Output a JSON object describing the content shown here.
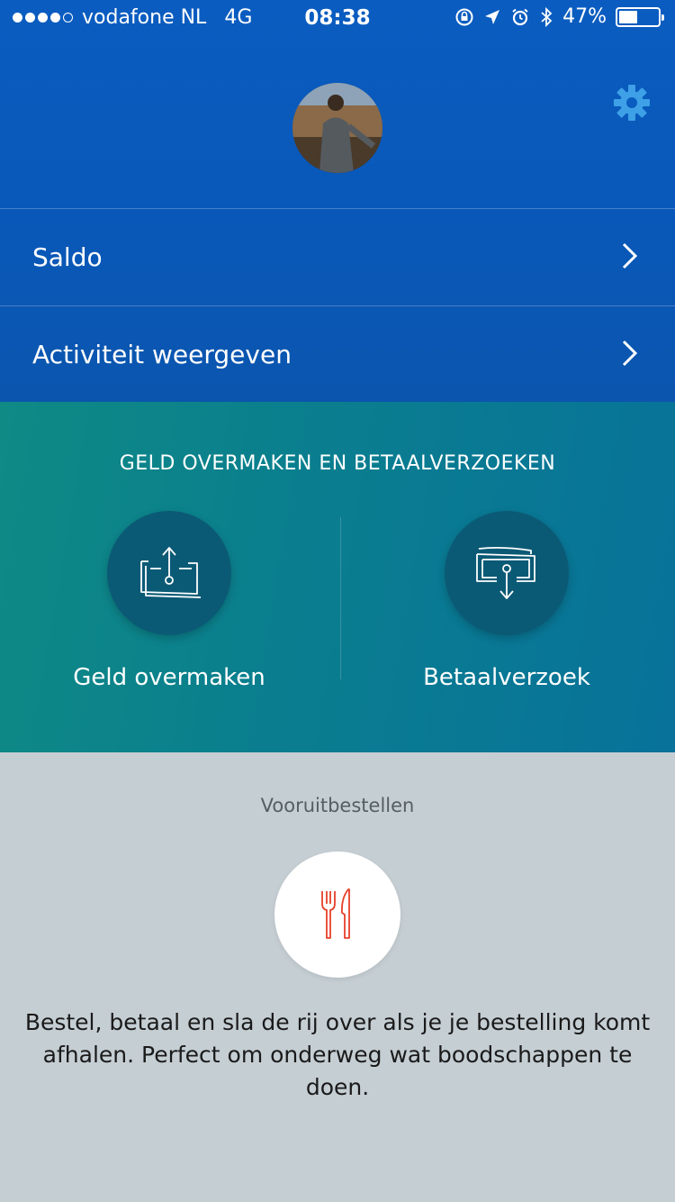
{
  "status_bar": {
    "carrier": "vodafone NL",
    "network": "4G",
    "time": "08:38",
    "battery": "47%",
    "battery_level": 0.47,
    "signal_filled": 4,
    "signal_total": 5
  },
  "header": {
    "avatar": "profile-photo",
    "settings_icon": "gear-icon"
  },
  "menu": [
    {
      "label": "Saldo",
      "icon": "chevron-right-icon"
    },
    {
      "label": "Activiteit weergeven",
      "icon": "chevron-right-icon"
    }
  ],
  "transfer_section": {
    "title": "GELD OVERMAKEN EN BETAALVERZOEKEN",
    "actions": [
      {
        "label": "Geld overmaken",
        "icon": "send-money-icon"
      },
      {
        "label": "Betaalverzoek",
        "icon": "request-money-icon"
      }
    ]
  },
  "preorder_section": {
    "title": "Vooruitbestellen",
    "icon": "fork-knife-icon",
    "description": "Bestel, betaal en sla de rij over als je je bestelling komt afhalen. Perfect om onderweg wat boodschappen te doen."
  },
  "colors": {
    "header_blue": "#0a5cc0",
    "teal": "#0a7f8e",
    "action_circle": "#0b5a75",
    "grey_bg": "#c5ced3",
    "gear": "#3ea0e6",
    "food_icon": "#e5402a"
  }
}
